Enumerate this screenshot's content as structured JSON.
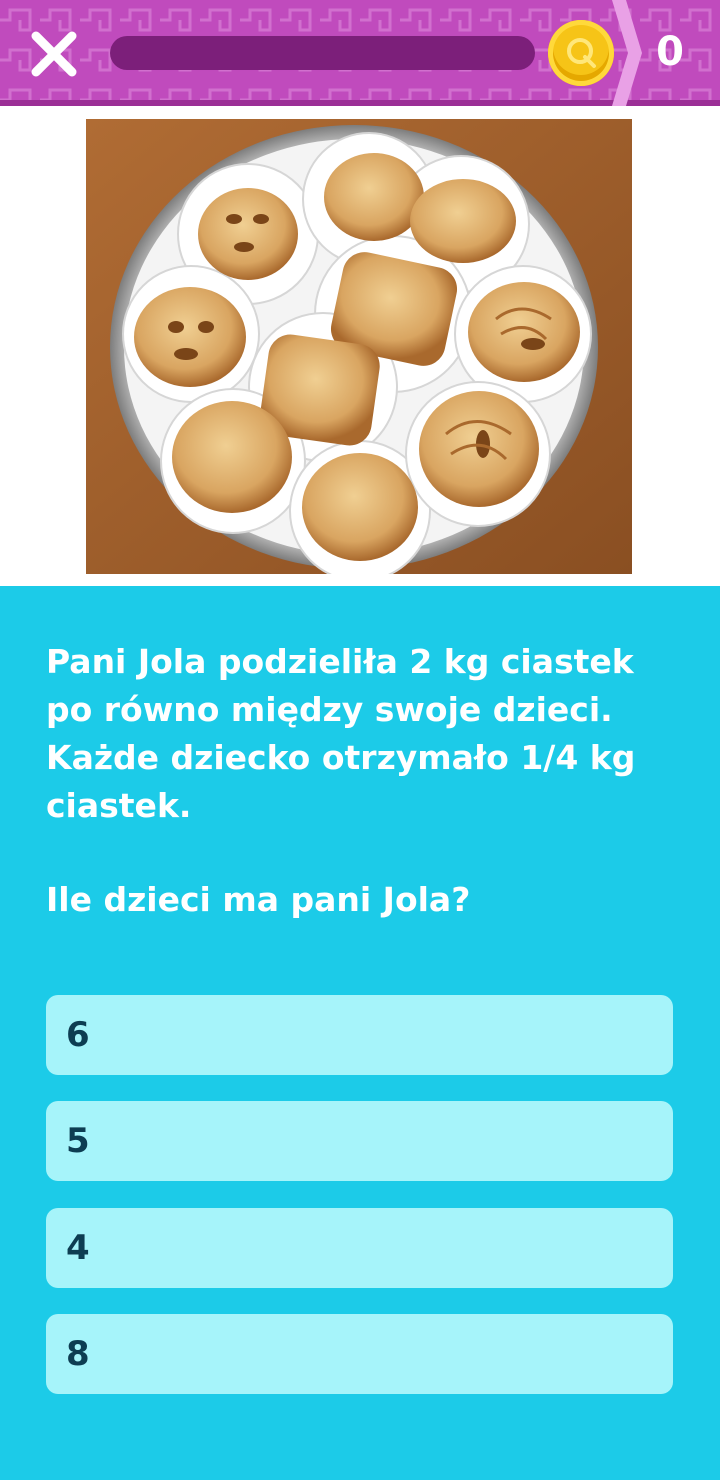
{
  "header": {
    "score": "0",
    "progress": 0,
    "close_icon": "close-icon",
    "coin_icon": "coin-icon"
  },
  "colors": {
    "header": "#c04bbd",
    "progress_track": "#7c1f7a",
    "background": "#1ccbe8",
    "answer": "#a6f4fa",
    "answer_text": "#0d3d52"
  },
  "question": {
    "lines": [
      "Pani Jola podzieliła 2 kg ciastek",
      "po równo między swoje dzieci.",
      "Każde dziecko otrzymało 1/4 kg",
      "ciastek."
    ],
    "prompt": "Ile dzieci ma pani Jola?"
  },
  "answers": [
    "6",
    "5",
    "4",
    "8"
  ]
}
